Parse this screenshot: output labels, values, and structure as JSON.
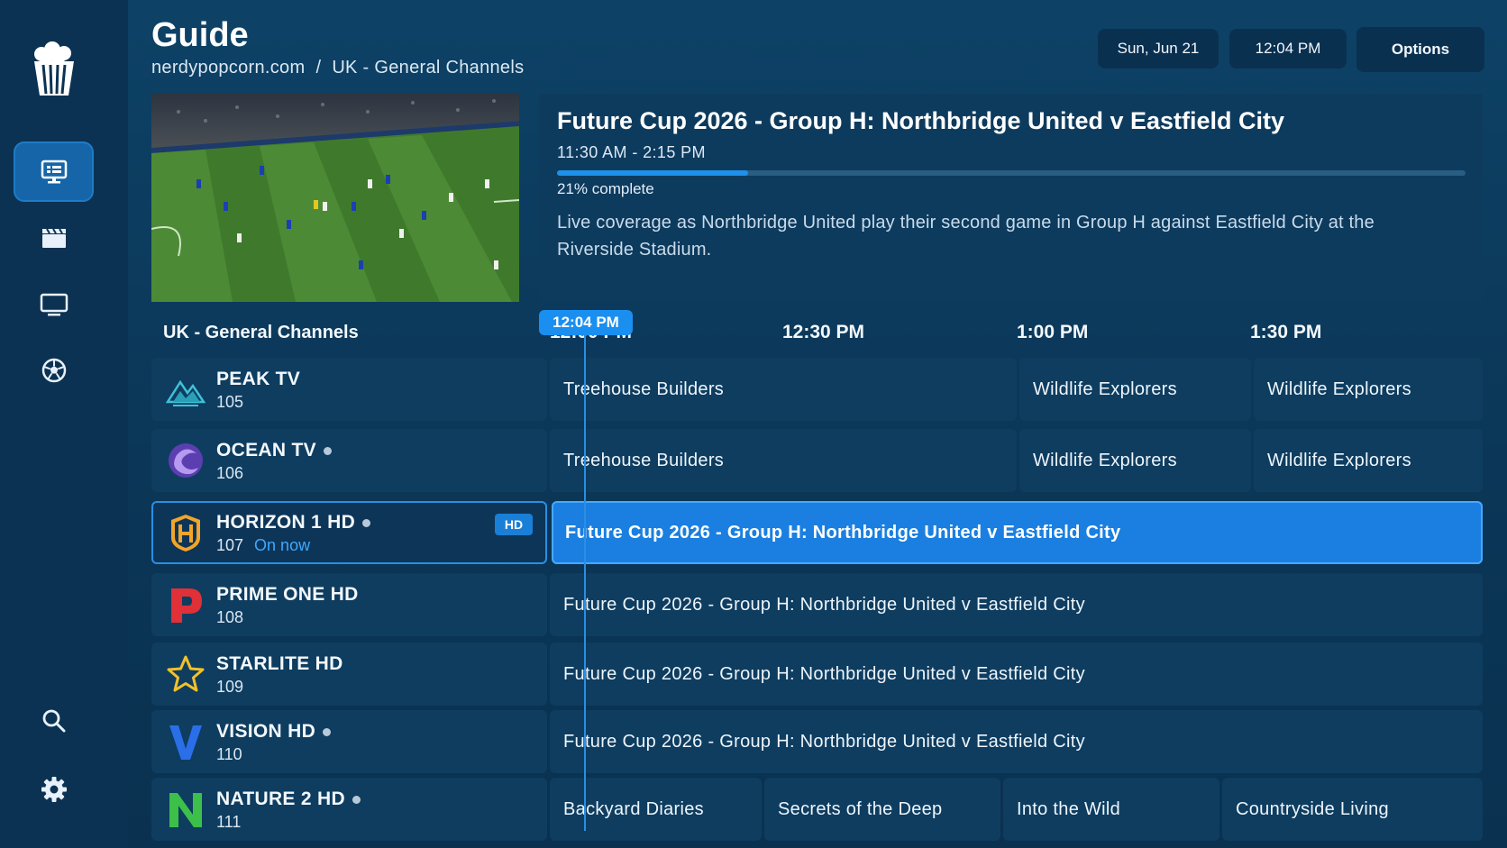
{
  "header": {
    "title": "Guide",
    "breadcrumb": [
      "nerdypopcorn.com",
      "UK - General Channels"
    ],
    "breadcrumb_sep": "/",
    "date": "Sun, Jun 21",
    "time": "12:04 PM",
    "options_label": "Options"
  },
  "sidebar": {
    "items": [
      {
        "name": "guide",
        "icon": "tv-guide-icon"
      },
      {
        "name": "movies",
        "icon": "clapperboard-icon"
      },
      {
        "name": "tv",
        "icon": "monitor-icon"
      },
      {
        "name": "sports",
        "icon": "soccer-ball-icon"
      },
      {
        "name": "search",
        "icon": "search-icon"
      },
      {
        "name": "settings",
        "icon": "gear-icon"
      }
    ],
    "active": "guide"
  },
  "preview": {
    "title": "Future Cup 2026 - Group H: Northbridge United v Eastfield City",
    "time": "11:30 AM - 2:15 PM",
    "progress": 21,
    "progress_text": "21% complete",
    "description": "Live coverage as Northbridge United play their second game in Group H against Eastfield City at the Riverside Stadium."
  },
  "timeline": {
    "group_title": "UK - General Channels",
    "now_label": "12:04 PM",
    "ticks": [
      "12:00 PM",
      "12:30 PM",
      "1:00 PM",
      "1:30 PM"
    ]
  },
  "channels": [
    {
      "name": "PEAK TV",
      "number": "105",
      "logo": "mountain-logo",
      "dot": false,
      "programs": [
        "Treehouse Builders",
        "Wildlife Explorers",
        "Wildlife Explorers"
      ]
    },
    {
      "name": "OCEAN TV",
      "number": "106",
      "logo": "wave-logo",
      "dot": true,
      "programs": [
        "Treehouse Builders",
        "Wildlife Explorers",
        "Wildlife Explorers"
      ]
    },
    {
      "name": "HORIZON 1 HD",
      "number": "107",
      "logo": "h-shield-logo",
      "dot": true,
      "on_now": "On now",
      "badge": "HD",
      "programs": [
        "Future Cup 2026 - Group H: Northbridge United v Eastfield City"
      ]
    },
    {
      "name": "PRIME ONE HD",
      "number": "108",
      "logo": "p-logo",
      "dot": false,
      "programs": [
        "Future Cup 2026 - Group H: Northbridge United v Eastfield City"
      ]
    },
    {
      "name": "STARLITE HD",
      "number": "109",
      "logo": "star-logo",
      "dot": false,
      "programs": [
        "Future Cup 2026 - Group H: Northbridge United v Eastfield City"
      ]
    },
    {
      "name": "VISION HD",
      "number": "110",
      "logo": "v-logo",
      "dot": true,
      "programs": [
        "Future Cup 2026 - Group H: Northbridge United v Eastfield City"
      ]
    },
    {
      "name": "NATURE 2 HD",
      "number": "111",
      "logo": "n-logo",
      "dot": true,
      "programs": [
        "Backyard Diaries",
        "Secrets of the Deep",
        "Into the Wild",
        "Countryside Living"
      ]
    }
  ],
  "colors": {
    "accent": "#1a8ff0",
    "background": "#0b3657",
    "cell": "#0e3d60"
  }
}
